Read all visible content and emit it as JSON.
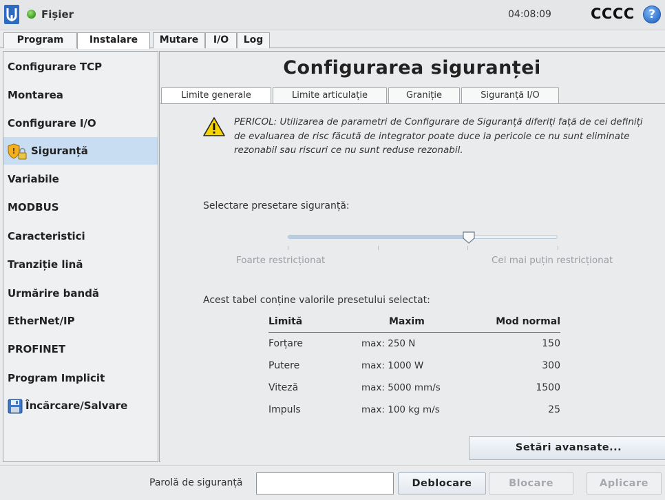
{
  "titlebar": {
    "file_menu_label": "Fișier",
    "clock": "04:08:09",
    "robot_name": "CCCC",
    "help_label": "?"
  },
  "main_tabs": [
    {
      "label": "Program",
      "active": false
    },
    {
      "label": "Instalare",
      "active": true
    },
    {
      "label": "Mutare",
      "active": false
    },
    {
      "label": "I/O",
      "active": false
    },
    {
      "label": "Log",
      "active": false
    }
  ],
  "sidebar": {
    "items": [
      {
        "label": "Configurare TCP"
      },
      {
        "label": "Montarea"
      },
      {
        "label": "Configurare I/O"
      },
      {
        "label": "Siguranță",
        "active": true,
        "icon": "safety-shield-lock-icon"
      },
      {
        "label": "Variabile"
      },
      {
        "label": "MODBUS"
      },
      {
        "label": "Caracteristici"
      },
      {
        "label": "Tranziție lină"
      },
      {
        "label": "Urmărire bandă"
      },
      {
        "label": "EtherNet/IP"
      },
      {
        "label": "PROFINET"
      },
      {
        "label": "Program Implicit"
      },
      {
        "label": "Încărcare/Salvare",
        "icon": "floppy-disk-icon"
      }
    ]
  },
  "main": {
    "title": "Configurarea siguranței",
    "sub_tabs": [
      {
        "label": "Limite generale",
        "active": true
      },
      {
        "label": "Limite articulație"
      },
      {
        "label": "Graniție"
      },
      {
        "label": "Siguranță I/O"
      }
    ],
    "warning_text": "PERICOL: Utilizarea de parametri de Configurare de Siguranță diferiți față de cei definiți de evaluarea de risc făcută de integrator poate duce la pericole ce nu sunt eliminate rezonabil sau riscuri ce nu sunt reduse rezonabil.",
    "preset_label": "Selectare presetare siguranță:",
    "slider": {
      "value_fraction": 0.67,
      "min_label": "Foarte restricționat",
      "max_label": "Cel mai puțin restricționat"
    },
    "table_intro": "Acest tabel conține valorile presetului selectat:",
    "table": {
      "headers": [
        "Limită",
        "Maxim",
        "Mod normal"
      ],
      "rows": [
        {
          "limit": "Forțare",
          "max": "max: 250 N",
          "normal": "150"
        },
        {
          "limit": "Putere",
          "max": "max: 1000 W",
          "normal": "300"
        },
        {
          "limit": "Viteză",
          "max": "max: 5000 mm/s",
          "normal": "1500"
        },
        {
          "limit": "Impuls",
          "max": "max: 100 kg m/s",
          "normal": "25"
        }
      ]
    },
    "advanced_button": "Setări avansate..."
  },
  "bottombar": {
    "password_label": "Parolă de siguranță",
    "password_value": "",
    "unlock_button": "Deblocare",
    "lock_button": "Blocare",
    "apply_button": "Aplicare"
  },
  "colors": {
    "accent_active": "#c9ddf2",
    "status_green": "#3c9a1e",
    "help_blue": "#2f6fc9"
  }
}
